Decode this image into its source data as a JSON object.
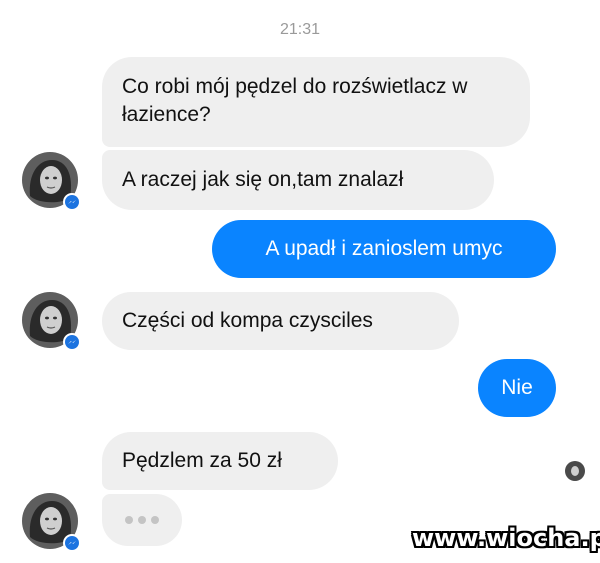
{
  "timestamp": "21:31",
  "messages": [
    {
      "direction": "incoming",
      "text": "Co robi mój pędzel do rozświetlacz w łazience?"
    },
    {
      "direction": "incoming",
      "text": "A raczej jak się on,tam znalazł"
    },
    {
      "direction": "outgoing",
      "text": "A upadł i zanioslem umyc"
    },
    {
      "direction": "incoming",
      "text": "Części od kompa czysciles"
    },
    {
      "direction": "outgoing",
      "text": "Nie"
    },
    {
      "direction": "incoming",
      "text": "Pędzlem za 50 zł"
    }
  ],
  "typing_indicator": {
    "icon": "typing-dots-icon"
  },
  "avatar_badge_icon": "messenger-icon",
  "watermark": "www.wiocha.pl",
  "colors": {
    "incoming_bubble": "#efefef",
    "outgoing_bubble": "#0a84ff",
    "badge": "#1d74e0",
    "timestamp": "#9a9a9a"
  }
}
